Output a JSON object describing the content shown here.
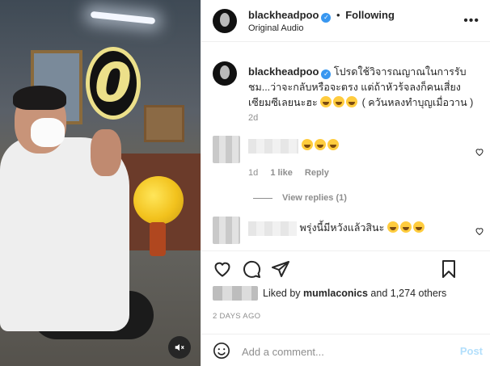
{
  "header": {
    "username": "blackheadpoo",
    "follow_status": "Following",
    "separator": "•",
    "audio": "Original Audio",
    "more": "•••"
  },
  "media": {
    "overlay_text": "0"
  },
  "caption": {
    "username": "blackheadpoo",
    "text_main": "โปรดใช้วิจารณญาณในการรับชม...ว่าจะกลับหรือจะตรง แต่ถ้าหัวร้จลงก็คนเสี่ยงเซียมซีเลยนะฮะ",
    "text_after": "( ควันหลงทำบุญเมื่อวาน )",
    "emoji_count": 3,
    "time": "2d"
  },
  "comments": [
    {
      "time": "1d",
      "likes": "1 like",
      "reply": "Reply",
      "emoji_count": 3
    },
    {
      "text": "พรุ่งนี้มีหวังแล้วสินะ",
      "emoji_count": 3
    }
  ],
  "view_replies": "View replies (1)",
  "likes": {
    "prefix": "Liked by",
    "user": "mumlaconics",
    "suffix": "and 1,274 others"
  },
  "post_age": "2 DAYS AGO",
  "add_comment": {
    "placeholder": "Add a comment...",
    "post_label": "Post"
  },
  "icons": {
    "heart": "heart-icon",
    "comment": "comment-icon",
    "share": "share-icon",
    "save": "bookmark-icon",
    "emoji": "emoji-icon",
    "mute": "mute-icon"
  }
}
